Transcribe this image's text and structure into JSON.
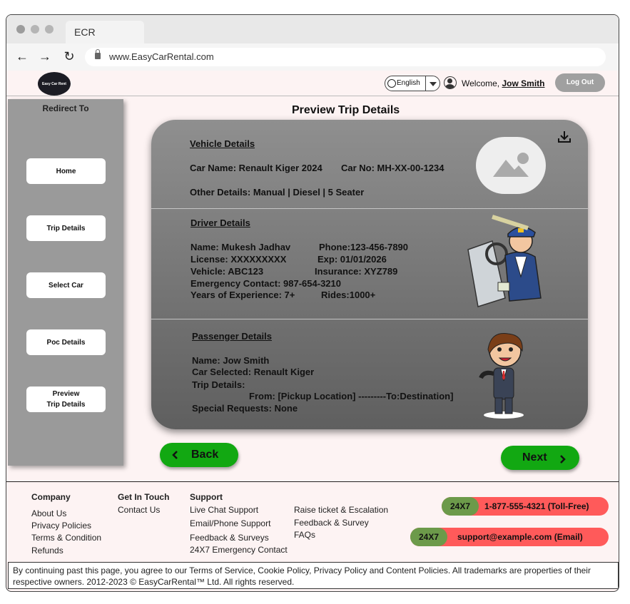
{
  "browser": {
    "tab_title": "ECR",
    "url": "www.EasyCarRental.com"
  },
  "header": {
    "logo_text": "Easy Car Rent",
    "language": "English",
    "welcome_prefix": "Welcome,",
    "user_name": "Jow Smith",
    "logout_label": "Log Out"
  },
  "sidebar": {
    "title": "Redirect To",
    "items": [
      {
        "label": "Home"
      },
      {
        "label": "Trip Details"
      },
      {
        "label": "Select Car"
      },
      {
        "label": "Poc Details"
      },
      {
        "label": "Preview\nTrip Details"
      }
    ]
  },
  "main": {
    "page_title": "Preview Trip Details",
    "vehicle": {
      "heading": "Vehicle Details",
      "car_name": "Car Name: Renault Kiger 2024",
      "car_no": "Car No: MH-XX-00-1234",
      "other": "Other Details: Manual | Diesel | 5 Seater"
    },
    "driver": {
      "heading": "Driver Details ",
      "name": "Name: Mukesh Jadhav",
      "phone": "Phone:123-456-7890",
      "license": "License: XXXXXXXXX",
      "exp": "Exp: 01/01/2026",
      "vehicle": "Vehicle: ABC123",
      "insurance": "Insurance: XYZ789",
      "emergency": "Emergency Contact: 987-654-3210",
      "experience": "Years of Experience: 7+",
      "rides": "Rides:1000+"
    },
    "passenger": {
      "heading": "Passenger Details ",
      "name": "Name: Jow Smith",
      "car_selected": "Car Selected: Renault Kiger",
      "trip_label": "Trip Details:",
      "from_to": "From: [Pickup Location] ---------To:Destination]",
      "special": "Special Requests: None"
    },
    "back_label": "Back",
    "next_label": "Next"
  },
  "footer": {
    "company": {
      "heading": "Company",
      "links": [
        "About Us",
        "Privacy Policies",
        "Terms & Condition",
        "Refunds"
      ]
    },
    "get_in_touch": {
      "heading": "Get In Touch",
      "links": [
        "Contact Us"
      ]
    },
    "support": {
      "heading": "Support",
      "links_col1": [
        "Live Chat Support",
        "Email/Phone Support",
        "Feedback & Surveys",
        "24X7 Emergency Contact"
      ],
      "links_col2": [
        "Raise ticket & Escalation",
        "Feedback & Survey",
        "FAQs"
      ]
    },
    "phone_tag": "24X7",
    "phone": "1-877-555-4321 (Toll-Free)",
    "email_tag": "24X7",
    "email": "support@example.com (Email)",
    "legal": "By continuing past this page, you agree to our Terms of Service, Cookie Policy, Privacy Policy and Content Policies. All trademarks are properties of their respective owners. 2012-2023 © EasyCarRental™ Ltd. All rights reserved."
  },
  "colors": {
    "green": "#12a812",
    "pill_red": "#ff5a5a",
    "pill_tag": "#6c9a4a",
    "card_gray": "#7a7a7a"
  }
}
